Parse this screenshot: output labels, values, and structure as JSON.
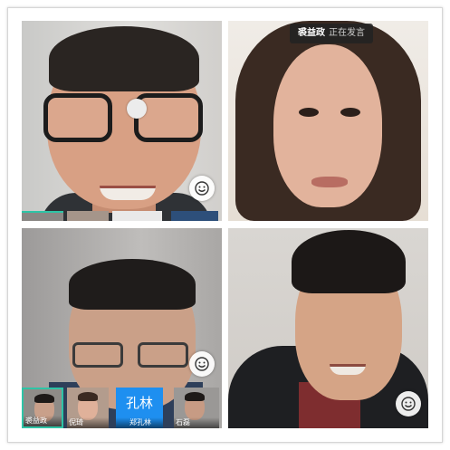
{
  "call": {
    "speaking_indicator": {
      "name": "裘益政",
      "status": "正在发言"
    },
    "tiles": [
      {
        "id": "tile-1",
        "emoji_icon": "smiley-icon"
      },
      {
        "id": "tile-2"
      },
      {
        "id": "tile-3",
        "emoji_icon": "smiley-icon"
      },
      {
        "id": "tile-4",
        "emoji_icon": "smiley-icon"
      }
    ],
    "participant_strip": [
      {
        "caption": "裘益政"
      },
      {
        "caption": "倪琦"
      },
      {
        "avatar_text": "孔林",
        "caption": "郑孔林"
      },
      {
        "caption": "石磊"
      }
    ]
  },
  "colors": {
    "active_border": "#2ec4a6",
    "avatar_blue": "#1e8ff0",
    "chip_bg": "#222222"
  }
}
